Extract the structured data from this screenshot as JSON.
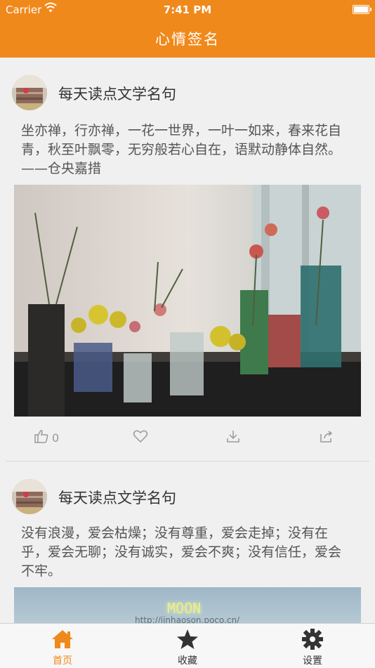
{
  "status": {
    "carrier": "Carrier",
    "time": "7:41 PM",
    "battery_level": 1.0
  },
  "nav": {
    "title": "心情签名"
  },
  "feed": {
    "posts": [
      {
        "author": "每天读点文学名句",
        "text": "坐亦禅，行亦禅，一花一世界，一叶一如来，春来花自青，秋至叶飘零，无穷般若心自在，语默动静体自然。——仓央嘉措",
        "likes": "0"
      },
      {
        "author": "每天读点文学名句",
        "text": "没有浪漫，爱会枯燥；没有尊重，爱会走掉；没有在乎，爱会无聊；没有诚实，爱会不爽；没有信任，爱会不牢。",
        "image_text": "MOON",
        "image_url_text": "http://jinhaoson.poco.cn/"
      }
    ]
  },
  "tabs": [
    {
      "label": "首页",
      "icon": "home-icon",
      "active": true
    },
    {
      "label": "收藏",
      "icon": "star-icon",
      "active": false
    },
    {
      "label": "设置",
      "icon": "gear-icon",
      "active": false
    }
  ],
  "colors": {
    "accent": "#f0891b",
    "inactive": "#333333"
  }
}
